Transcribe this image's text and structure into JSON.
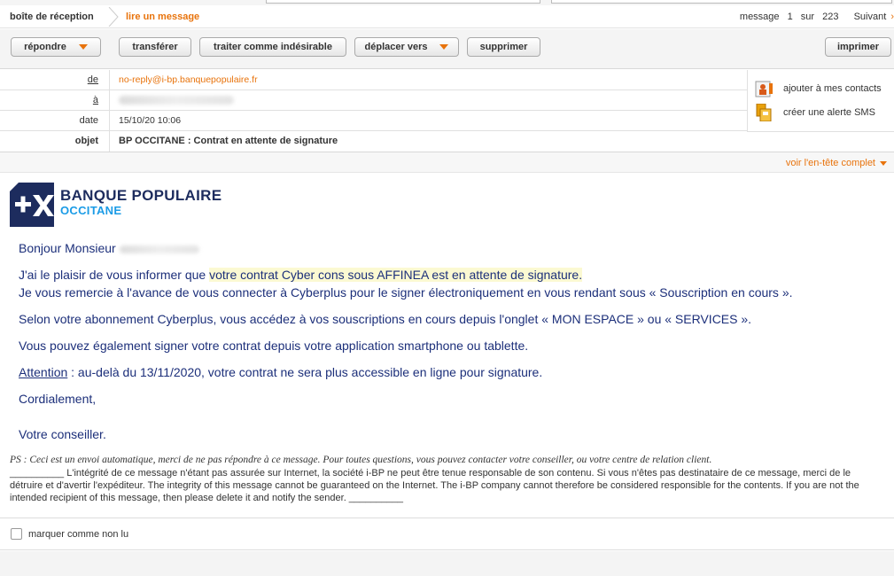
{
  "breadcrumb": {
    "inbox": "boîte de réception",
    "current": "lire un message"
  },
  "pager": {
    "message_label": "message",
    "index": "1",
    "of_label": "sur",
    "total": "223",
    "next_label": "Suivant",
    "next_glyph": "›"
  },
  "toolbar": {
    "reply": "répondre",
    "forward": "transférer",
    "mark_spam": "traiter comme indésirable",
    "move_to": "déplacer vers",
    "delete": "supprimer",
    "print": "imprimer"
  },
  "header": {
    "from_label": "de",
    "from_value": "no-reply@i-bp.banquepopulaire.fr",
    "to_label": "à",
    "date_label": "date",
    "date_value": "15/10/20 10:06",
    "subject_label": "objet",
    "subject_value": "BP OCCITANE : Contrat en attente de signature",
    "add_contacts": "ajouter à mes contacts",
    "sms_alert": "créer une alerte SMS",
    "full_header": "voir l'en-tête complet"
  },
  "logo": {
    "line1": "BANQUE POPULAIRE",
    "line2": "OCCITANE",
    "colors": {
      "navy": "#1d2c5e",
      "blue": "#1a9be6"
    }
  },
  "message": {
    "greeting": "Bonjour Monsieur",
    "p1_start": "J'ai le plaisir de vous informer que ",
    "p1_highlight": "votre contrat Cyber cons sous AFFINEA est en attente de signature.",
    "p2": "Je vous remercie à l'avance de vous connecter à Cyberplus pour le signer électroniquement en vous rendant sous « Souscription en cours ».",
    "p3": "Selon votre abonnement Cyberplus, vous accédez à vos souscriptions en cours depuis l'onglet « MON ESPACE » ou « SERVICES ».",
    "p4": "Vous pouvez également signer votre contrat depuis votre application smartphone ou tablette.",
    "p5_label": "Attention",
    "p5_text": " : au-delà du 13/11/2020, votre contrat ne sera plus accessible en ligne pour signature.",
    "closing": "Cordialement,",
    "signature": "Votre conseiller."
  },
  "ps": "PS : Ceci est un envoi automatique, merci de ne pas répondre à ce message. Pour toutes questions, vous pouvez contacter votre conseiller, ou votre centre de relation client.",
  "disclaimer": "__________   L'intégrité de ce message n'étant pas assurée sur Internet, la société i-BP ne peut être tenue responsable de son contenu. Si vous n'êtes pas destinataire de ce message, merci de le détruire et d'avertir l'expéditeur.  The integrity of this message cannot be guaranteed on the Internet. The i-BP company cannot therefore be considered responsible for the contents. If you are not the intended recipient of this message, then please delete it and notify the sender.  __________",
  "mark_unread": "marquer comme non lu",
  "colors": {
    "accent": "#e8730c",
    "body_text": "#1c2f7a"
  }
}
